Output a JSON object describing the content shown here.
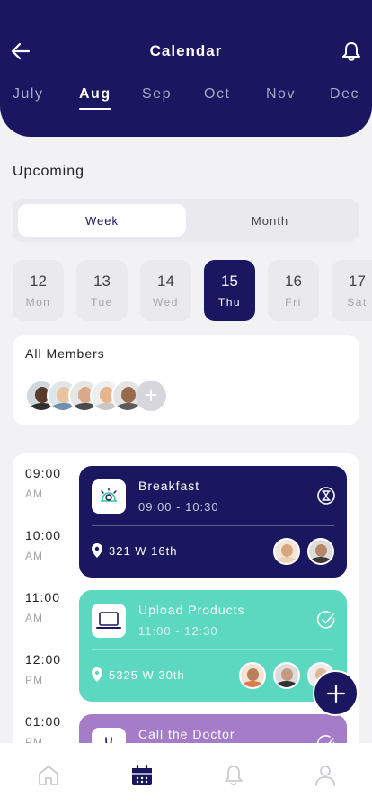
{
  "header": {
    "title": "Calendar"
  },
  "months": [
    "July",
    "Aug",
    "Sep",
    "Oct",
    "Nov",
    "Dec"
  ],
  "active_month": "Aug",
  "upcoming": {
    "title": "Upcoming"
  },
  "toggle": {
    "week": "Week",
    "month": "Month",
    "active": "Week"
  },
  "days": [
    {
      "num": "12",
      "dow": "Mon"
    },
    {
      "num": "13",
      "dow": "Tue"
    },
    {
      "num": "14",
      "dow": "Wed"
    },
    {
      "num": "15",
      "dow": "Thu"
    },
    {
      "num": "16",
      "dow": "Fri"
    },
    {
      "num": "17",
      "dow": "Sat"
    }
  ],
  "active_day": "15",
  "members": {
    "title": "All Members"
  },
  "timeline": [
    {
      "hour": "09:00",
      "ampm": "AM"
    },
    {
      "hour": "10:00",
      "ampm": "AM"
    },
    {
      "hour": "11:00",
      "ampm": "AM"
    },
    {
      "hour": "12:00",
      "ampm": "PM"
    },
    {
      "hour": "01:00",
      "ampm": "PM"
    }
  ],
  "events": [
    {
      "title": "Breakfast",
      "time": "09:00 - 10:30",
      "location": "321 W 16th",
      "color": "#1a1760",
      "icon": "breakfast-icon",
      "status": "timer-icon"
    },
    {
      "title": "Upload Products",
      "time": "11:00 - 12:30",
      "location": "5325 W 30th",
      "color": "#5cd8c0",
      "icon": "laptop-icon",
      "status": "check-circle-icon"
    },
    {
      "title": "Call the Doctor",
      "time": "",
      "location": "",
      "color": "#a47cc8",
      "icon": "doctor-icon",
      "status": "check-circle-icon"
    }
  ],
  "colors": {
    "primary": "#1a1760",
    "teal": "#5cd8c0",
    "purple": "#a47cc8",
    "background": "#f2f2f4"
  },
  "tabbar": [
    "home-icon",
    "calendar-icon",
    "bell-icon",
    "profile-icon"
  ],
  "active_tab": "calendar-icon"
}
